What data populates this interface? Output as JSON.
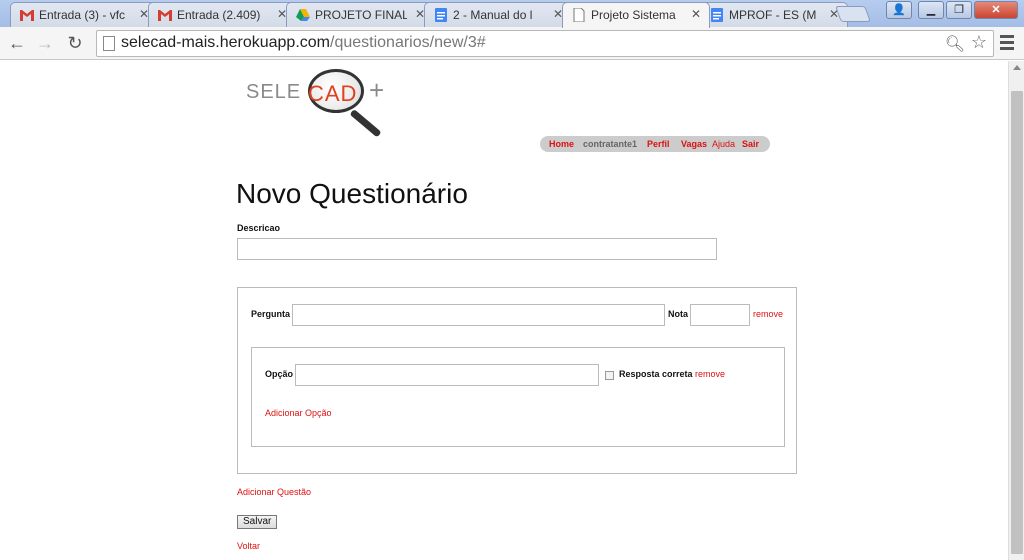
{
  "browser": {
    "tabs": [
      {
        "label": "Entrada (3) - vfc",
        "icon": "gmail-icon"
      },
      {
        "label": "Entrada (2.409)",
        "icon": "gmail-icon"
      },
      {
        "label": "PROJETO FINAL",
        "icon": "drive-icon"
      },
      {
        "label": "2 - Manual do l",
        "icon": "docs-icon"
      },
      {
        "label": "Projeto Sistema",
        "icon": "page-icon"
      },
      {
        "label": "MPROF - ES (M",
        "icon": "docs-icon"
      }
    ],
    "url_host": "selecad-mais.herokuapp.com",
    "url_path": "/questionarios/new/3#"
  },
  "logo": {
    "sele": "SELE",
    "cad": "CAD",
    "plus": "+"
  },
  "nav": {
    "home": "Home",
    "user": "contratante1",
    "perfil": "Perfil",
    "vagas": "Vagas",
    "ajuda": "Ajuda",
    "sair": "Sair"
  },
  "form": {
    "title": "Novo Questionário",
    "descricao_label": "Descricao",
    "descricao_value": "",
    "question": {
      "pergunta_label": "Pergunta",
      "pergunta_value": "",
      "nota_label": "Nota",
      "nota_value": "",
      "remove": "remove",
      "option": {
        "opcao_label": "Opção",
        "opcao_value": "",
        "correct_label": "Resposta correta",
        "remove": "remove"
      },
      "add_option": "Adicionar Opção"
    },
    "add_question": "Adicionar Questão",
    "save": "Salvar",
    "back": "Voltar"
  },
  "colors": {
    "link": "#dd1111",
    "logo_cad": "#e0401f"
  }
}
